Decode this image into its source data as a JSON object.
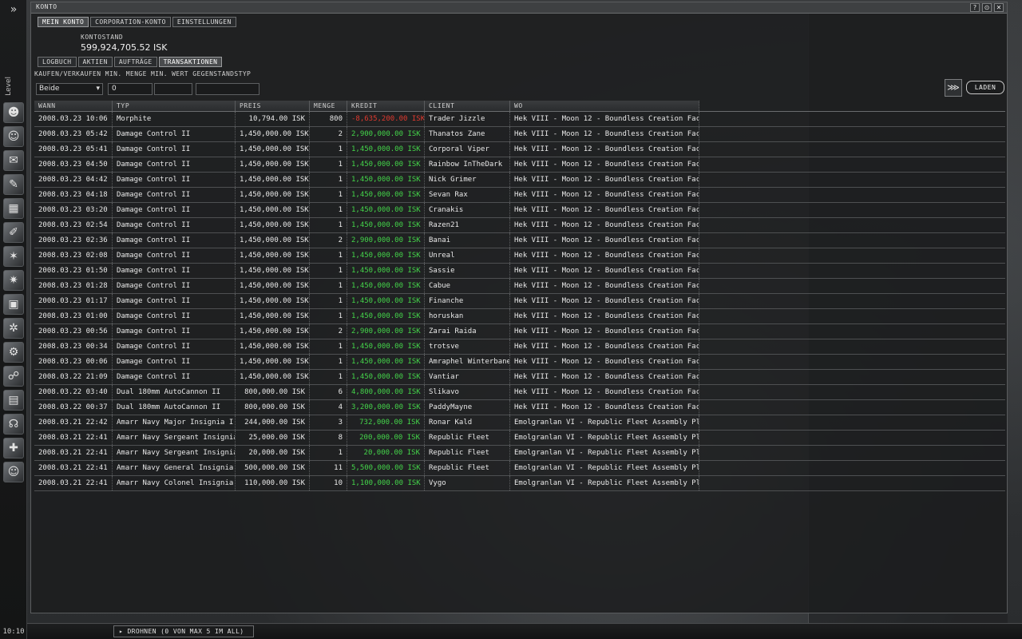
{
  "window": {
    "title": "KONTO",
    "controls": [
      "?",
      "⊙",
      "✕"
    ]
  },
  "main_tabs": [
    {
      "label": "MEIN KONTO",
      "active": true
    },
    {
      "label": "CORPORATION-KONTO",
      "active": false
    },
    {
      "label": "EINSTELLUNGEN",
      "active": false
    }
  ],
  "balance": {
    "label": "KONTOSTAND",
    "value": "599,924,705.52 ISK"
  },
  "sub_tabs": [
    {
      "label": "LOGBUCH",
      "active": false
    },
    {
      "label": "AKTIEN",
      "active": false
    },
    {
      "label": "AUFTRÄGE",
      "active": false
    },
    {
      "label": "TRANSAKTIONEN",
      "active": true
    }
  ],
  "filter": {
    "label": "KAUFEN/VERKAUFEN MIN. MENGE MIN. WERT GEGENSTANDSTYP",
    "buy_sell": "Beide",
    "min_qty": "0",
    "min_value": "",
    "item_type": ""
  },
  "load_button": "LADEN",
  "columns": [
    "WANN",
    "TYP",
    "PREIS",
    "MENGE",
    "KREDIT",
    "CLIENT",
    "WO"
  ],
  "rows": [
    {
      "when": "2008.03.23 10:06",
      "type": "Morphite",
      "price": "10,794.00 ISK",
      "qty": "800",
      "credit": "-8,635,200.00 ISK",
      "neg": true,
      "client": "Trader Jizzle",
      "where": "Hek VIII - Moon 12 - Boundless Creation Factory"
    },
    {
      "when": "2008.03.23 05:42",
      "type": "Damage Control II",
      "price": "1,450,000.00 ISK",
      "qty": "2",
      "credit": "2,900,000.00 ISK",
      "client": "Thanatos Zane",
      "where": "Hek VIII - Moon 12 - Boundless Creation Factory"
    },
    {
      "when": "2008.03.23 05:41",
      "type": "Damage Control II",
      "price": "1,450,000.00 ISK",
      "qty": "1",
      "credit": "1,450,000.00 ISK",
      "client": "Corporal Viper",
      "where": "Hek VIII - Moon 12 - Boundless Creation Factory"
    },
    {
      "when": "2008.03.23 04:50",
      "type": "Damage Control II",
      "price": "1,450,000.00 ISK",
      "qty": "1",
      "credit": "1,450,000.00 ISK",
      "client": "Rainbow InTheDark",
      "where": "Hek VIII - Moon 12 - Boundless Creation Factory"
    },
    {
      "when": "2008.03.23 04:42",
      "type": "Damage Control II",
      "price": "1,450,000.00 ISK",
      "qty": "1",
      "credit": "1,450,000.00 ISK",
      "client": "Nick Grimer",
      "where": "Hek VIII - Moon 12 - Boundless Creation Factory"
    },
    {
      "when": "2008.03.23 04:18",
      "type": "Damage Control II",
      "price": "1,450,000.00 ISK",
      "qty": "1",
      "credit": "1,450,000.00 ISK",
      "client": "Sevan Rax",
      "where": "Hek VIII - Moon 12 - Boundless Creation Factory"
    },
    {
      "when": "2008.03.23 03:20",
      "type": "Damage Control II",
      "price": "1,450,000.00 ISK",
      "qty": "1",
      "credit": "1,450,000.00 ISK",
      "client": "Cranakis",
      "where": "Hek VIII - Moon 12 - Boundless Creation Factory"
    },
    {
      "when": "2008.03.23 02:54",
      "type": "Damage Control II",
      "price": "1,450,000.00 ISK",
      "qty": "1",
      "credit": "1,450,000.00 ISK",
      "client": "Razen21",
      "where": "Hek VIII - Moon 12 - Boundless Creation Factory"
    },
    {
      "when": "2008.03.23 02:36",
      "type": "Damage Control II",
      "price": "1,450,000.00 ISK",
      "qty": "2",
      "credit": "2,900,000.00 ISK",
      "client": "Banai",
      "where": "Hek VIII - Moon 12 - Boundless Creation Factory"
    },
    {
      "when": "2008.03.23 02:08",
      "type": "Damage Control II",
      "price": "1,450,000.00 ISK",
      "qty": "1",
      "credit": "1,450,000.00 ISK",
      "client": "Unreal",
      "where": "Hek VIII - Moon 12 - Boundless Creation Factory"
    },
    {
      "when": "2008.03.23 01:50",
      "type": "Damage Control II",
      "price": "1,450,000.00 ISK",
      "qty": "1",
      "credit": "1,450,000.00 ISK",
      "client": "Sassie",
      "where": "Hek VIII - Moon 12 - Boundless Creation Factory"
    },
    {
      "when": "2008.03.23 01:28",
      "type": "Damage Control II",
      "price": "1,450,000.00 ISK",
      "qty": "1",
      "credit": "1,450,000.00 ISK",
      "client": "Cabue",
      "where": "Hek VIII - Moon 12 - Boundless Creation Factory"
    },
    {
      "when": "2008.03.23 01:17",
      "type": "Damage Control II",
      "price": "1,450,000.00 ISK",
      "qty": "1",
      "credit": "1,450,000.00 ISK",
      "client": "Finanche",
      "where": "Hek VIII - Moon 12 - Boundless Creation Factory"
    },
    {
      "when": "2008.03.23 01:00",
      "type": "Damage Control II",
      "price": "1,450,000.00 ISK",
      "qty": "1",
      "credit": "1,450,000.00 ISK",
      "client": "horuskan",
      "where": "Hek VIII - Moon 12 - Boundless Creation Factory"
    },
    {
      "when": "2008.03.23 00:56",
      "type": "Damage Control II",
      "price": "1,450,000.00 ISK",
      "qty": "2",
      "credit": "2,900,000.00 ISK",
      "client": "Zarai Raida",
      "where": "Hek VIII - Moon 12 - Boundless Creation Factory"
    },
    {
      "when": "2008.03.23 00:34",
      "type": "Damage Control II",
      "price": "1,450,000.00 ISK",
      "qty": "1",
      "credit": "1,450,000.00 ISK",
      "client": "trotsve",
      "where": "Hek VIII - Moon 12 - Boundless Creation Factory"
    },
    {
      "when": "2008.03.23 00:06",
      "type": "Damage Control II",
      "price": "1,450,000.00 ISK",
      "qty": "1",
      "credit": "1,450,000.00 ISK",
      "client": "Amraphel Winterbane",
      "where": "Hek VIII - Moon 12 - Boundless Creation Factory"
    },
    {
      "when": "2008.03.22 21:09",
      "type": "Damage Control II",
      "price": "1,450,000.00 ISK",
      "qty": "1",
      "credit": "1,450,000.00 ISK",
      "client": "Vantiar",
      "where": "Hek VIII - Moon 12 - Boundless Creation Factory"
    },
    {
      "when": "2008.03.22 03:40",
      "type": "Dual 180mm AutoCannon II",
      "price": "800,000.00 ISK",
      "qty": "6",
      "credit": "4,800,000.00 ISK",
      "client": "Slikavo",
      "where": "Hek VIII - Moon 12 - Boundless Creation Factory"
    },
    {
      "when": "2008.03.22 00:37",
      "type": "Dual 180mm AutoCannon II",
      "price": "800,000.00 ISK",
      "qty": "4",
      "credit": "3,200,000.00 ISK",
      "client": "PaddyMayne",
      "where": "Hek VIII - Moon 12 - Boundless Creation Factory"
    },
    {
      "when": "2008.03.21 22:42",
      "type": "Amarr Navy Major Insignia I",
      "price": "244,000.00 ISK",
      "qty": "3",
      "credit": "732,000.00 ISK",
      "client": "Ronar Kald",
      "where": "Emolgranlan VI - Republic Fleet Assembly Plant"
    },
    {
      "when": "2008.03.21 22:41",
      "type": "Amarr Navy Sergeant Insignia II",
      "price": "25,000.00 ISK",
      "qty": "8",
      "credit": "200,000.00 ISK",
      "client": "Republic Fleet",
      "where": "Emolgranlan VI - Republic Fleet Assembly Plant"
    },
    {
      "when": "2008.03.21 22:41",
      "type": "Amarr Navy Sergeant Insignia I",
      "price": "20,000.00 ISK",
      "qty": "1",
      "credit": "20,000.00 ISK",
      "client": "Republic Fleet",
      "where": "Emolgranlan VI - Republic Fleet Assembly Plant"
    },
    {
      "when": "2008.03.21 22:41",
      "type": "Amarr Navy General Insignia I",
      "price": "500,000.00 ISK",
      "qty": "11",
      "credit": "5,500,000.00 ISK",
      "client": "Republic Fleet",
      "where": "Emolgranlan VI - Republic Fleet Assembly Plant"
    },
    {
      "when": "2008.03.21 22:41",
      "type": "Amarr Navy Colonel Insignia I",
      "price": "110,000.00 ISK",
      "qty": "10",
      "credit": "1,100,000.00 ISK",
      "client": "Vygo",
      "where": "Emolgranlan VI - Republic Fleet Assembly Plant"
    }
  ],
  "sidebar": {
    "level_label": "Level",
    "icons": [
      "character-sheet-icon",
      "people-icon",
      "mail-icon",
      "notepad-icon",
      "map-icon",
      "journal-icon",
      "starmap-icon",
      "scanner-icon",
      "assets-icon",
      "skills-icon",
      "fitting-icon",
      "market-icon",
      "news-icon",
      "voice-icon",
      "help-icon",
      "contacts-icon"
    ],
    "clock": "10:10"
  },
  "bottom": {
    "drones_label": "DROHNEN (0 VON MAX 5 IM ALL)"
  },
  "colors": {
    "credit_positive": "#44d44a",
    "credit_negative": "#e03a2f"
  }
}
